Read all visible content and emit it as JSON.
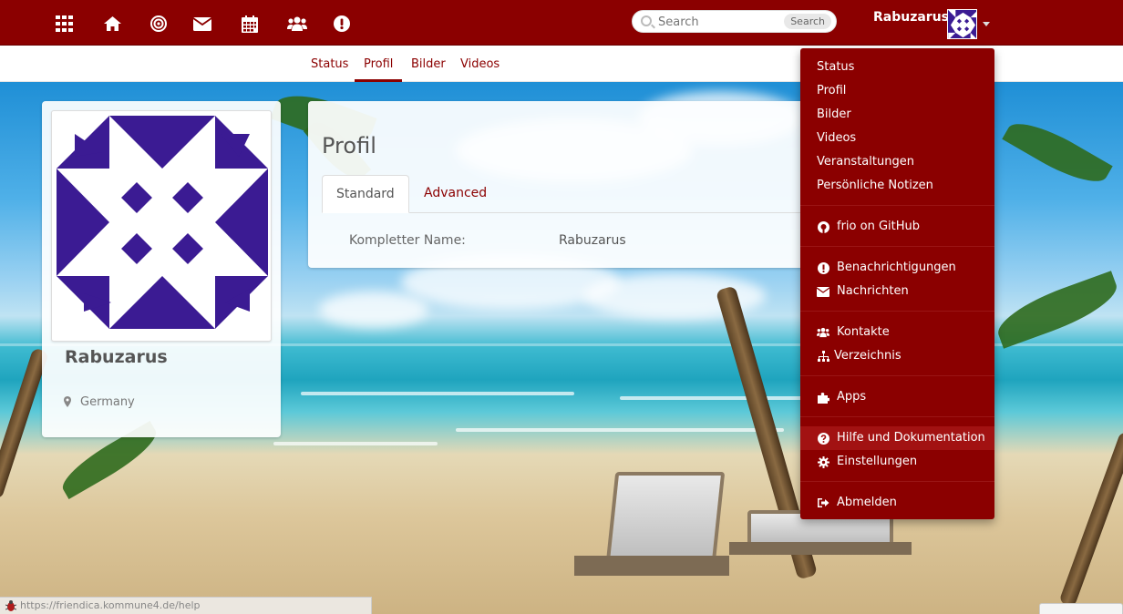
{
  "topbar": {
    "icons": [
      "apps-grid-icon",
      "home-icon",
      "target-icon",
      "envelope-icon",
      "calendar-icon",
      "users-icon",
      "exclamation-icon"
    ],
    "search": {
      "placeholder": "Search",
      "button_label": "Search"
    },
    "username": "Rabuzarus"
  },
  "subnav": {
    "tabs": [
      {
        "label": "Status"
      },
      {
        "label": "Profil",
        "active": true
      },
      {
        "label": "Bilder"
      },
      {
        "label": "Videos"
      }
    ]
  },
  "profile_card": {
    "name": "Rabuzarus",
    "location": "Germany"
  },
  "main_card": {
    "title": "Profil",
    "tabs": [
      {
        "label": "Standard",
        "active": true
      },
      {
        "label": "Advanced"
      }
    ],
    "field": {
      "label": "Kompletter Name:",
      "value": "Rabuzarus"
    }
  },
  "dropdown": {
    "items": [
      {
        "label": "Status"
      },
      {
        "label": "Profil"
      },
      {
        "label": "Bilder"
      },
      {
        "label": "Videos"
      },
      {
        "label": "Veranstaltungen"
      },
      {
        "label": "Persönliche Notizen"
      },
      {
        "label": "frio on GitHub",
        "icon": "github-icon"
      },
      {
        "label": "Benachrichtigungen",
        "icon": "exclamation-circle-icon"
      },
      {
        "label": "Nachrichten",
        "icon": "envelope-icon"
      },
      {
        "label": "Kontakte",
        "icon": "users-icon"
      },
      {
        "label": "Verzeichnis",
        "icon": "sitemap-icon"
      },
      {
        "label": "Apps",
        "icon": "puzzle-icon"
      },
      {
        "label": "Hilfe und Dokumentation",
        "icon": "question-circle-icon",
        "highlighted": true
      },
      {
        "label": "Einstellungen",
        "icon": "gear-icon"
      },
      {
        "label": "Abmelden",
        "icon": "sign-out-icon"
      }
    ]
  },
  "statusbar": {
    "url": "https://friendica.kommune4.de/help"
  },
  "colors": {
    "brand": "#8b0000",
    "avatar_bg": "#3b1b93"
  }
}
